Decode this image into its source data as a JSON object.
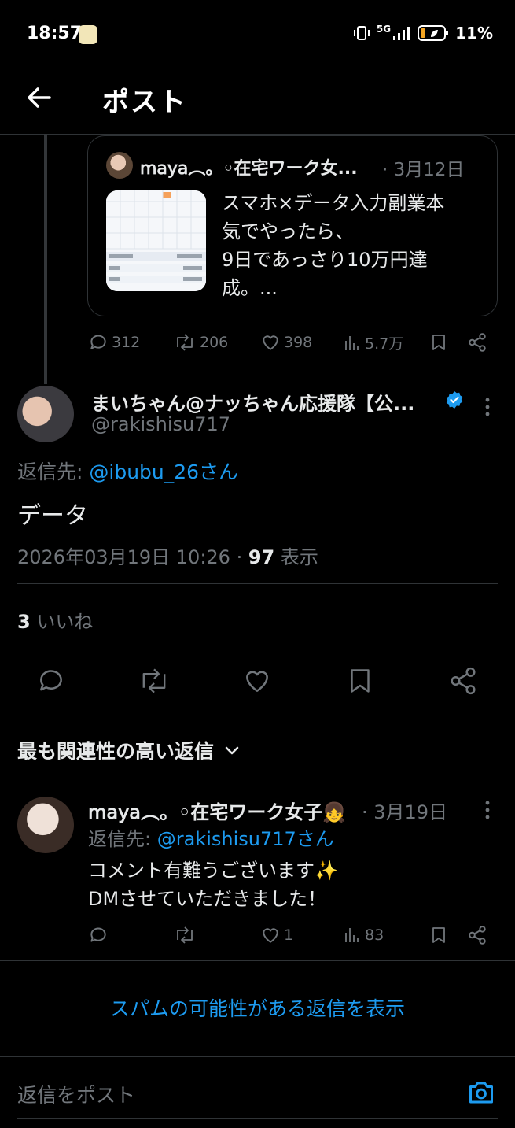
{
  "status_bar": {
    "time": "18:57",
    "network": "5G",
    "battery": "11%"
  },
  "header": {
    "title": "ポスト"
  },
  "quoted_post": {
    "author": "𝗆𝖺𝗒𝖺︵。◦在宅ワーク女...",
    "date": "· 3月12日",
    "text_lines": [
      "スマホ×データ入力副業本",
      "気でやったら、",
      "9日であっさり10万円達",
      "成。..."
    ],
    "stats": {
      "replies": "312",
      "reposts": "206",
      "likes": "398",
      "views": "5.7万"
    }
  },
  "post": {
    "author": "まいちゃん@ナッちゃん応援隊【公...",
    "handle": "@rakishisu717",
    "reply_to_prefix": "返信先: ",
    "reply_to_mention": "@ibubu_26さん",
    "text": "データ",
    "timestamp": "2026年03月19日 10:26 · ",
    "views_count": "97",
    "views_label": " 表示",
    "likes_count": "3",
    "likes_label": " いいね"
  },
  "sort_label": "最も関連性の高い返信",
  "reply": {
    "author": "𝗆𝖺𝗒𝖺︵。◦在宅ワーク女子👧",
    "date": "· 3月19日",
    "reply_to_prefix": "返信先: ",
    "reply_to_mention": "@rakishisu717さん",
    "text_lines": [
      "コメント有難うございます✨",
      "DMさせていただきました！"
    ],
    "stats": {
      "replies": "",
      "reposts": "",
      "likes": "1",
      "views": "83"
    }
  },
  "spam_link": "スパムの可能性がある返信を表示",
  "compose_placeholder": "返信をポスト",
  "colors": {
    "accent": "#1d9bf0",
    "muted": "#71767b",
    "text": "#e7e9ea",
    "border": "#2f3336"
  }
}
